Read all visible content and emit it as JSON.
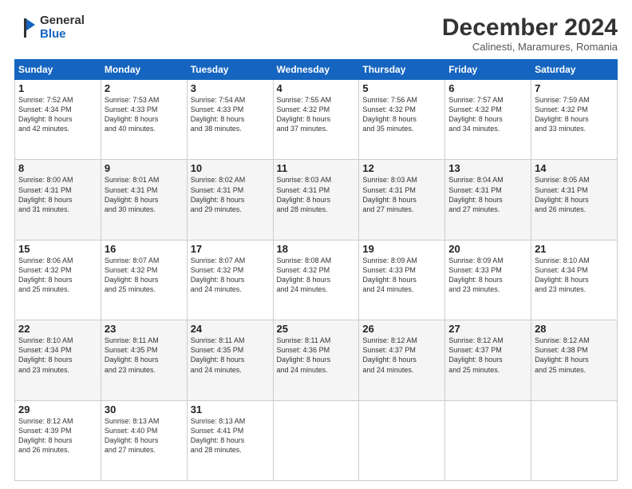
{
  "logo": {
    "general": "General",
    "blue": "Blue"
  },
  "header": {
    "month": "December 2024",
    "location": "Calinesti, Maramures, Romania"
  },
  "weekdays": [
    "Sunday",
    "Monday",
    "Tuesday",
    "Wednesday",
    "Thursday",
    "Friday",
    "Saturday"
  ],
  "weeks": [
    [
      {
        "day": "1",
        "info": "Sunrise: 7:52 AM\nSunset: 4:34 PM\nDaylight: 8 hours\nand 42 minutes."
      },
      {
        "day": "2",
        "info": "Sunrise: 7:53 AM\nSunset: 4:33 PM\nDaylight: 8 hours\nand 40 minutes."
      },
      {
        "day": "3",
        "info": "Sunrise: 7:54 AM\nSunset: 4:33 PM\nDaylight: 8 hours\nand 38 minutes."
      },
      {
        "day": "4",
        "info": "Sunrise: 7:55 AM\nSunset: 4:32 PM\nDaylight: 8 hours\nand 37 minutes."
      },
      {
        "day": "5",
        "info": "Sunrise: 7:56 AM\nSunset: 4:32 PM\nDaylight: 8 hours\nand 35 minutes."
      },
      {
        "day": "6",
        "info": "Sunrise: 7:57 AM\nSunset: 4:32 PM\nDaylight: 8 hours\nand 34 minutes."
      },
      {
        "day": "7",
        "info": "Sunrise: 7:59 AM\nSunset: 4:32 PM\nDaylight: 8 hours\nand 33 minutes."
      }
    ],
    [
      {
        "day": "8",
        "info": "Sunrise: 8:00 AM\nSunset: 4:31 PM\nDaylight: 8 hours\nand 31 minutes."
      },
      {
        "day": "9",
        "info": "Sunrise: 8:01 AM\nSunset: 4:31 PM\nDaylight: 8 hours\nand 30 minutes."
      },
      {
        "day": "10",
        "info": "Sunrise: 8:02 AM\nSunset: 4:31 PM\nDaylight: 8 hours\nand 29 minutes."
      },
      {
        "day": "11",
        "info": "Sunrise: 8:03 AM\nSunset: 4:31 PM\nDaylight: 8 hours\nand 28 minutes."
      },
      {
        "day": "12",
        "info": "Sunrise: 8:03 AM\nSunset: 4:31 PM\nDaylight: 8 hours\nand 27 minutes."
      },
      {
        "day": "13",
        "info": "Sunrise: 8:04 AM\nSunset: 4:31 PM\nDaylight: 8 hours\nand 27 minutes."
      },
      {
        "day": "14",
        "info": "Sunrise: 8:05 AM\nSunset: 4:31 PM\nDaylight: 8 hours\nand 26 minutes."
      }
    ],
    [
      {
        "day": "15",
        "info": "Sunrise: 8:06 AM\nSunset: 4:32 PM\nDaylight: 8 hours\nand 25 minutes."
      },
      {
        "day": "16",
        "info": "Sunrise: 8:07 AM\nSunset: 4:32 PM\nDaylight: 8 hours\nand 25 minutes."
      },
      {
        "day": "17",
        "info": "Sunrise: 8:07 AM\nSunset: 4:32 PM\nDaylight: 8 hours\nand 24 minutes."
      },
      {
        "day": "18",
        "info": "Sunrise: 8:08 AM\nSunset: 4:32 PM\nDaylight: 8 hours\nand 24 minutes."
      },
      {
        "day": "19",
        "info": "Sunrise: 8:09 AM\nSunset: 4:33 PM\nDaylight: 8 hours\nand 24 minutes."
      },
      {
        "day": "20",
        "info": "Sunrise: 8:09 AM\nSunset: 4:33 PM\nDaylight: 8 hours\nand 23 minutes."
      },
      {
        "day": "21",
        "info": "Sunrise: 8:10 AM\nSunset: 4:34 PM\nDaylight: 8 hours\nand 23 minutes."
      }
    ],
    [
      {
        "day": "22",
        "info": "Sunrise: 8:10 AM\nSunset: 4:34 PM\nDaylight: 8 hours\nand 23 minutes."
      },
      {
        "day": "23",
        "info": "Sunrise: 8:11 AM\nSunset: 4:35 PM\nDaylight: 8 hours\nand 23 minutes."
      },
      {
        "day": "24",
        "info": "Sunrise: 8:11 AM\nSunset: 4:35 PM\nDaylight: 8 hours\nand 24 minutes."
      },
      {
        "day": "25",
        "info": "Sunrise: 8:11 AM\nSunset: 4:36 PM\nDaylight: 8 hours\nand 24 minutes."
      },
      {
        "day": "26",
        "info": "Sunrise: 8:12 AM\nSunset: 4:37 PM\nDaylight: 8 hours\nand 24 minutes."
      },
      {
        "day": "27",
        "info": "Sunrise: 8:12 AM\nSunset: 4:37 PM\nDaylight: 8 hours\nand 25 minutes."
      },
      {
        "day": "28",
        "info": "Sunrise: 8:12 AM\nSunset: 4:38 PM\nDaylight: 8 hours\nand 25 minutes."
      }
    ],
    [
      {
        "day": "29",
        "info": "Sunrise: 8:12 AM\nSunset: 4:39 PM\nDaylight: 8 hours\nand 26 minutes."
      },
      {
        "day": "30",
        "info": "Sunrise: 8:13 AM\nSunset: 4:40 PM\nDaylight: 8 hours\nand 27 minutes."
      },
      {
        "day": "31",
        "info": "Sunrise: 8:13 AM\nSunset: 4:41 PM\nDaylight: 8 hours\nand 28 minutes."
      },
      null,
      null,
      null,
      null
    ]
  ]
}
